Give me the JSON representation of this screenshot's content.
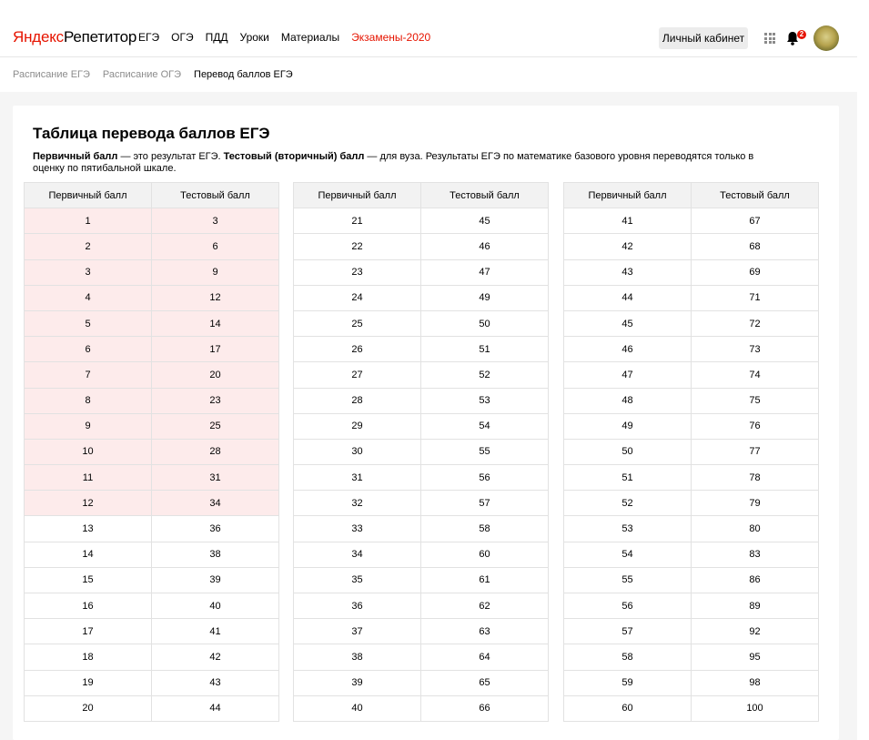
{
  "header": {
    "logo_brand": "Яндекс",
    "logo_product": "Репетитор",
    "nav": [
      {
        "label": "ЕГЭ"
      },
      {
        "label": "ОГЭ"
      },
      {
        "label": "ПДД"
      },
      {
        "label": "Уроки"
      },
      {
        "label": "Материалы"
      },
      {
        "label": "Экзамены-2020",
        "accent": true
      }
    ],
    "cabinet_label": "Личный кабинет",
    "notifications_count": "2",
    "accent_color": "#e61400"
  },
  "breadcrumbs": [
    {
      "label": "Расписание ЕГЭ"
    },
    {
      "label": "Расписание ОГЭ"
    },
    {
      "label": "Перевод баллов ЕГЭ",
      "current": true
    }
  ],
  "main": {
    "title": "Таблица перевода баллов ЕГЭ",
    "desc_primary_term": "Первичный балл",
    "desc_primary_text": " — это результат ЕГЭ. ",
    "desc_test_term": "Тестовый (вторичный) балл",
    "desc_test_text": " — для вуза. Результаты ЕГЭ по математике базового уровня переводятся только в оценку по пятибальной шкале.",
    "col_primary": "Первичный балл",
    "col_test": "Тестовый балл",
    "highlight_color": "#fdebeb",
    "tables": [
      {
        "rows": [
          {
            "p": "1",
            "t": "3",
            "hl": true
          },
          {
            "p": "2",
            "t": "6",
            "hl": true
          },
          {
            "p": "3",
            "t": "9",
            "hl": true
          },
          {
            "p": "4",
            "t": "12",
            "hl": true
          },
          {
            "p": "5",
            "t": "14",
            "hl": true
          },
          {
            "p": "6",
            "t": "17",
            "hl": true
          },
          {
            "p": "7",
            "t": "20",
            "hl": true
          },
          {
            "p": "8",
            "t": "23",
            "hl": true
          },
          {
            "p": "9",
            "t": "25",
            "hl": true
          },
          {
            "p": "10",
            "t": "28",
            "hl": true
          },
          {
            "p": "11",
            "t": "31",
            "hl": true
          },
          {
            "p": "12",
            "t": "34",
            "hl": true
          },
          {
            "p": "13",
            "t": "36"
          },
          {
            "p": "14",
            "t": "38"
          },
          {
            "p": "15",
            "t": "39"
          },
          {
            "p": "16",
            "t": "40"
          },
          {
            "p": "17",
            "t": "41"
          },
          {
            "p": "18",
            "t": "42"
          },
          {
            "p": "19",
            "t": "43"
          },
          {
            "p": "20",
            "t": "44"
          }
        ]
      },
      {
        "rows": [
          {
            "p": "21",
            "t": "45"
          },
          {
            "p": "22",
            "t": "46"
          },
          {
            "p": "23",
            "t": "47"
          },
          {
            "p": "24",
            "t": "49"
          },
          {
            "p": "25",
            "t": "50"
          },
          {
            "p": "26",
            "t": "51"
          },
          {
            "p": "27",
            "t": "52"
          },
          {
            "p": "28",
            "t": "53"
          },
          {
            "p": "29",
            "t": "54"
          },
          {
            "p": "30",
            "t": "55"
          },
          {
            "p": "31",
            "t": "56"
          },
          {
            "p": "32",
            "t": "57"
          },
          {
            "p": "33",
            "t": "58"
          },
          {
            "p": "34",
            "t": "60"
          },
          {
            "p": "35",
            "t": "61"
          },
          {
            "p": "36",
            "t": "62"
          },
          {
            "p": "37",
            "t": "63"
          },
          {
            "p": "38",
            "t": "64"
          },
          {
            "p": "39",
            "t": "65"
          },
          {
            "p": "40",
            "t": "66"
          }
        ]
      },
      {
        "rows": [
          {
            "p": "41",
            "t": "67"
          },
          {
            "p": "42",
            "t": "68"
          },
          {
            "p": "43",
            "t": "69"
          },
          {
            "p": "44",
            "t": "71"
          },
          {
            "p": "45",
            "t": "72"
          },
          {
            "p": "46",
            "t": "73"
          },
          {
            "p": "47",
            "t": "74"
          },
          {
            "p": "48",
            "t": "75"
          },
          {
            "p": "49",
            "t": "76"
          },
          {
            "p": "50",
            "t": "77"
          },
          {
            "p": "51",
            "t": "78"
          },
          {
            "p": "52",
            "t": "79"
          },
          {
            "p": "53",
            "t": "80"
          },
          {
            "p": "54",
            "t": "83"
          },
          {
            "p": "55",
            "t": "86"
          },
          {
            "p": "56",
            "t": "89"
          },
          {
            "p": "57",
            "t": "92"
          },
          {
            "p": "58",
            "t": "95"
          },
          {
            "p": "59",
            "t": "98"
          },
          {
            "p": "60",
            "t": "100"
          }
        ]
      }
    ]
  }
}
